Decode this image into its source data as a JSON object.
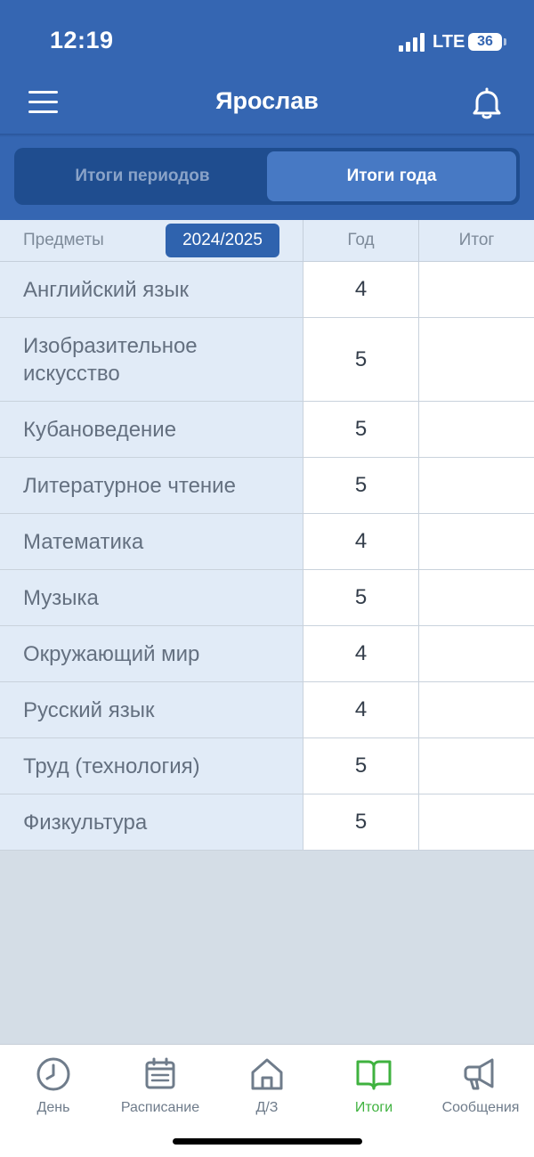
{
  "status_bar": {
    "time": "12:19",
    "network": "LTE",
    "battery": "36"
  },
  "header": {
    "title": "Ярослав",
    "menu_icon": "hamburger-icon",
    "bell_icon": "bell-icon"
  },
  "segments": {
    "periods": "Итоги периодов",
    "year": "Итоги года",
    "active": "year"
  },
  "table": {
    "headers": {
      "subject": "Предметы",
      "year_badge": "2024/2025",
      "god": "Год",
      "itog": "Итог"
    },
    "rows": [
      {
        "subject": "Английский язык",
        "year": "4",
        "final": ""
      },
      {
        "subject": "Изобразительное искусство",
        "year": "5",
        "final": ""
      },
      {
        "subject": "Кубановедение",
        "year": "5",
        "final": ""
      },
      {
        "subject": "Литературное чтение",
        "year": "5",
        "final": ""
      },
      {
        "subject": "Математика",
        "year": "4",
        "final": ""
      },
      {
        "subject": "Музыка",
        "year": "5",
        "final": ""
      },
      {
        "subject": "Окружающий мир",
        "year": "4",
        "final": ""
      },
      {
        "subject": "Русский язык",
        "year": "4",
        "final": ""
      },
      {
        "subject": "Труд (технология)",
        "year": "5",
        "final": ""
      },
      {
        "subject": "Физкультура",
        "year": "5",
        "final": ""
      }
    ]
  },
  "tabbar": {
    "items": [
      {
        "label": "День",
        "icon": "clock-icon"
      },
      {
        "label": "Расписание",
        "icon": "calendar-icon"
      },
      {
        "label": "Д/З",
        "icon": "home-icon"
      },
      {
        "label": "Итоги",
        "icon": "book-icon"
      },
      {
        "label": "Сообщения",
        "icon": "megaphone-icon"
      }
    ],
    "active": "Итоги"
  },
  "colors": {
    "header": "#3566b2",
    "segment_bg": "#1f4d8f",
    "segment_active": "#4779c4",
    "year_badge": "#2f63ae",
    "subject_cell": "#e1ebf7",
    "tab_active": "#3fb23f",
    "tab_inactive": "#6f7c8b",
    "page_bg": "#d4dde6"
  }
}
